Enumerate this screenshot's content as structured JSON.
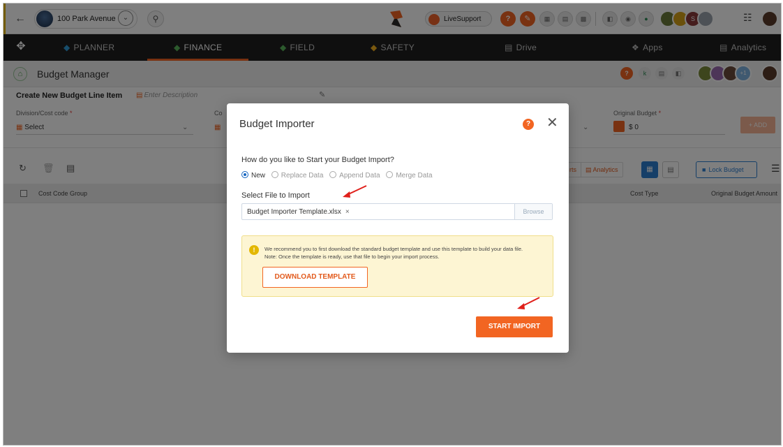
{
  "topbar": {
    "project_name": "100 Park Avenue",
    "live_support": "LiveSupport",
    "user_initial": "S"
  },
  "nav": {
    "items": [
      {
        "label": "PLANNER",
        "icon": "tag-icon"
      },
      {
        "label": "FINANCE",
        "icon": "tag-icon"
      },
      {
        "label": "FIELD",
        "icon": "tag-icon"
      },
      {
        "label": "SAFETY",
        "icon": "tag-icon"
      },
      {
        "label": "Drive",
        "icon": "drive-icon"
      },
      {
        "label": "Apps",
        "icon": "apps-icon"
      },
      {
        "label": "Analytics",
        "icon": "analytics-icon"
      }
    ],
    "active": "FINANCE"
  },
  "page": {
    "title": "Budget Manager",
    "more_avatars": "+1"
  },
  "form": {
    "line_title": "Create New Budget Line Item",
    "description_placeholder": "Enter Description",
    "division_label": "Division/Cost code",
    "division_value": "Select",
    "cost_type_label_partial": "Co",
    "original_budget_label": "Original Budget",
    "original_budget_value": "$ 0",
    "add_button": "+ ADD"
  },
  "toolbar": {
    "reports_partial": "rts",
    "analytics": "Analytics",
    "lock_budget": "Lock Budget"
  },
  "table": {
    "headers": [
      "Cost Code Group",
      "Cost Type",
      "Original Budget Amount"
    ]
  },
  "modal": {
    "title": "Budget Importer",
    "question": "How do you like to Start your Budget Import?",
    "options": [
      "New",
      "Replace Data",
      "Append Data",
      "Merge Data"
    ],
    "selected_option": "New",
    "select_file_label": "Select File to Import",
    "file_name": "Budget Importer Template.xlsx",
    "browse_button": "Browse",
    "note_line1": "We recommend you to first download the standard budget template and use this template to build your data file.",
    "note_line2": "Note: Once the template is ready, use that file to begin your import process.",
    "download_button": "DOWNLOAD TEMPLATE",
    "start_button": "START IMPORT"
  },
  "colors": {
    "accent": "#f26522",
    "nav_bg": "#1f1f1f",
    "link_blue": "#2c7fd1",
    "note_bg": "#fdf5d3"
  }
}
